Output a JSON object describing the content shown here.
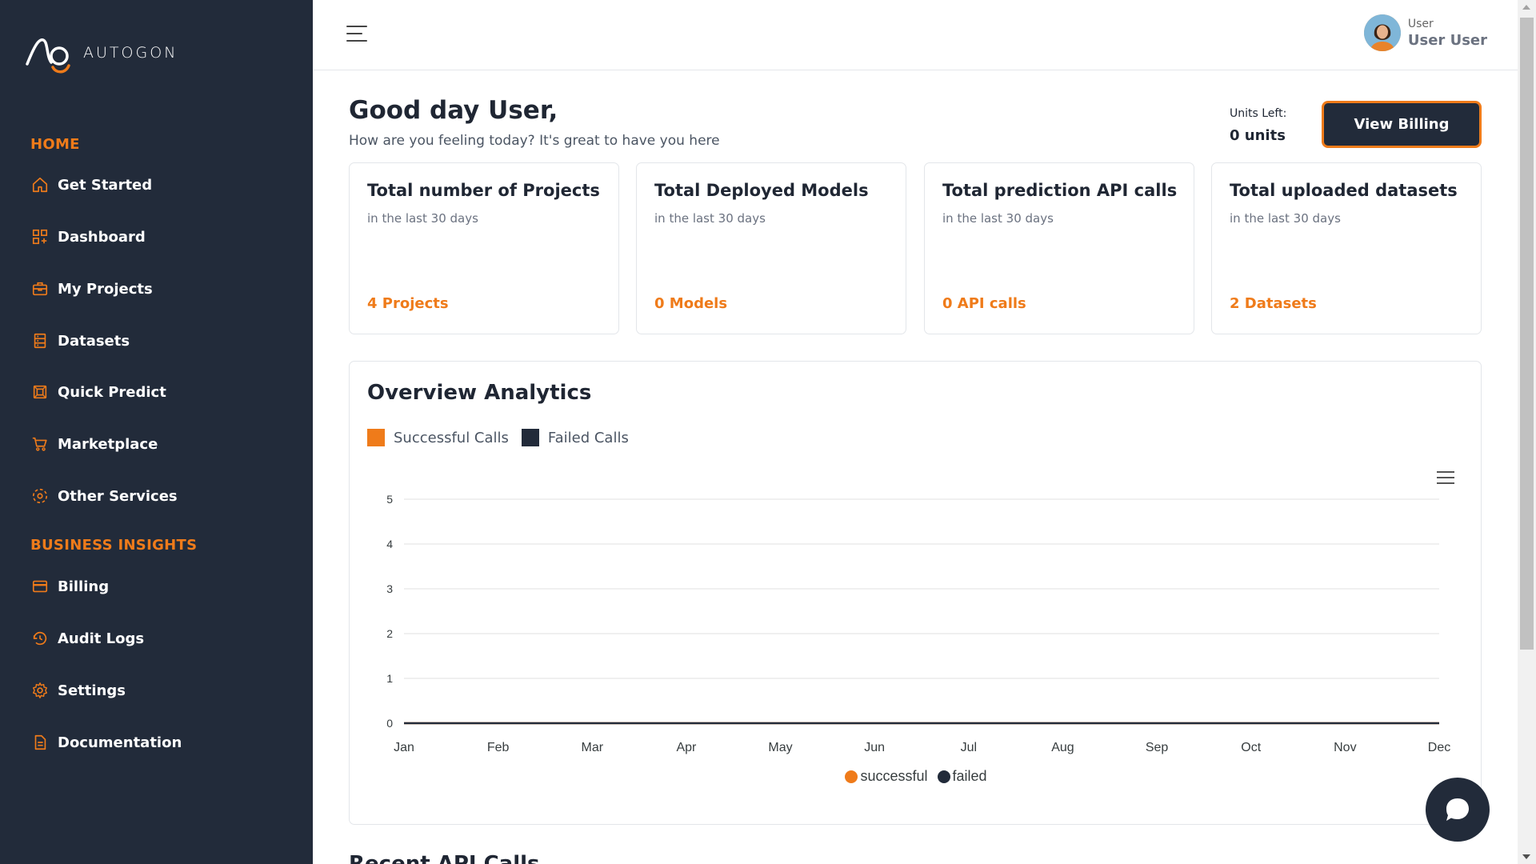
{
  "brand": {
    "name": "AUTOGON"
  },
  "sidebar": {
    "sections": [
      {
        "label": "HOME"
      },
      {
        "label": "BUSINESS INSIGHTS"
      }
    ],
    "items": [
      {
        "label": "Get Started",
        "icon": "home-icon"
      },
      {
        "label": "Dashboard",
        "icon": "dashboard-icon"
      },
      {
        "label": "My Projects",
        "icon": "briefcase-icon"
      },
      {
        "label": "Datasets",
        "icon": "dataset-icon"
      },
      {
        "label": "Quick Predict",
        "icon": "predict-icon"
      },
      {
        "label": "Marketplace",
        "icon": "cart-icon"
      },
      {
        "label": "Other Services",
        "icon": "services-icon"
      },
      {
        "label": "Billing",
        "icon": "card-icon"
      },
      {
        "label": "Audit Logs",
        "icon": "history-icon"
      },
      {
        "label": "Settings",
        "icon": "gear-icon"
      },
      {
        "label": "Documentation",
        "icon": "document-icon"
      }
    ]
  },
  "header": {
    "user_role": "User",
    "user_name": "User User"
  },
  "main": {
    "greeting": "Good day User,",
    "subgreeting": "How are you feeling today? It's great to have you here",
    "units_label": "Units Left:",
    "units_value": "0 units",
    "billing_button": "View Billing",
    "cards": [
      {
        "title": "Total number of Projects",
        "sub": "in the last 30 days",
        "value": "4 Projects"
      },
      {
        "title": "Total Deployed Models",
        "sub": "in the last 30 days",
        "value": "0 Models"
      },
      {
        "title": "Total prediction API calls",
        "sub": "in the last 30 days",
        "value": "0 API calls"
      },
      {
        "title": "Total uploaded datasets",
        "sub": "in the last 30 days",
        "value": "2 Datasets"
      }
    ],
    "analytics": {
      "title": "Overview Analytics",
      "legend_top": [
        "Successful Calls",
        "Failed Calls"
      ]
    },
    "recent_title": "Recent API Calls"
  },
  "colors": {
    "accent": "#ef7b1a",
    "navy": "#222b3a"
  },
  "chart_data": {
    "type": "line",
    "categories": [
      "Jan",
      "Feb",
      "Mar",
      "Apr",
      "May",
      "Jun",
      "Jul",
      "Aug",
      "Sep",
      "Oct",
      "Nov",
      "Dec"
    ],
    "series": [
      {
        "name": "successful",
        "values": [
          0,
          0,
          0,
          0,
          0,
          0,
          0,
          0,
          0,
          0,
          0,
          0
        ],
        "color": "#ef7b1a"
      },
      {
        "name": "failed",
        "values": [
          0,
          0,
          0,
          0,
          0,
          0,
          0,
          0,
          0,
          0,
          0,
          0
        ],
        "color": "#222b3a"
      }
    ],
    "yticks": [
      "0",
      "1",
      "2",
      "3",
      "4",
      "5"
    ],
    "ylim": [
      0,
      5
    ],
    "grid": true,
    "legend": "bottom-center"
  }
}
